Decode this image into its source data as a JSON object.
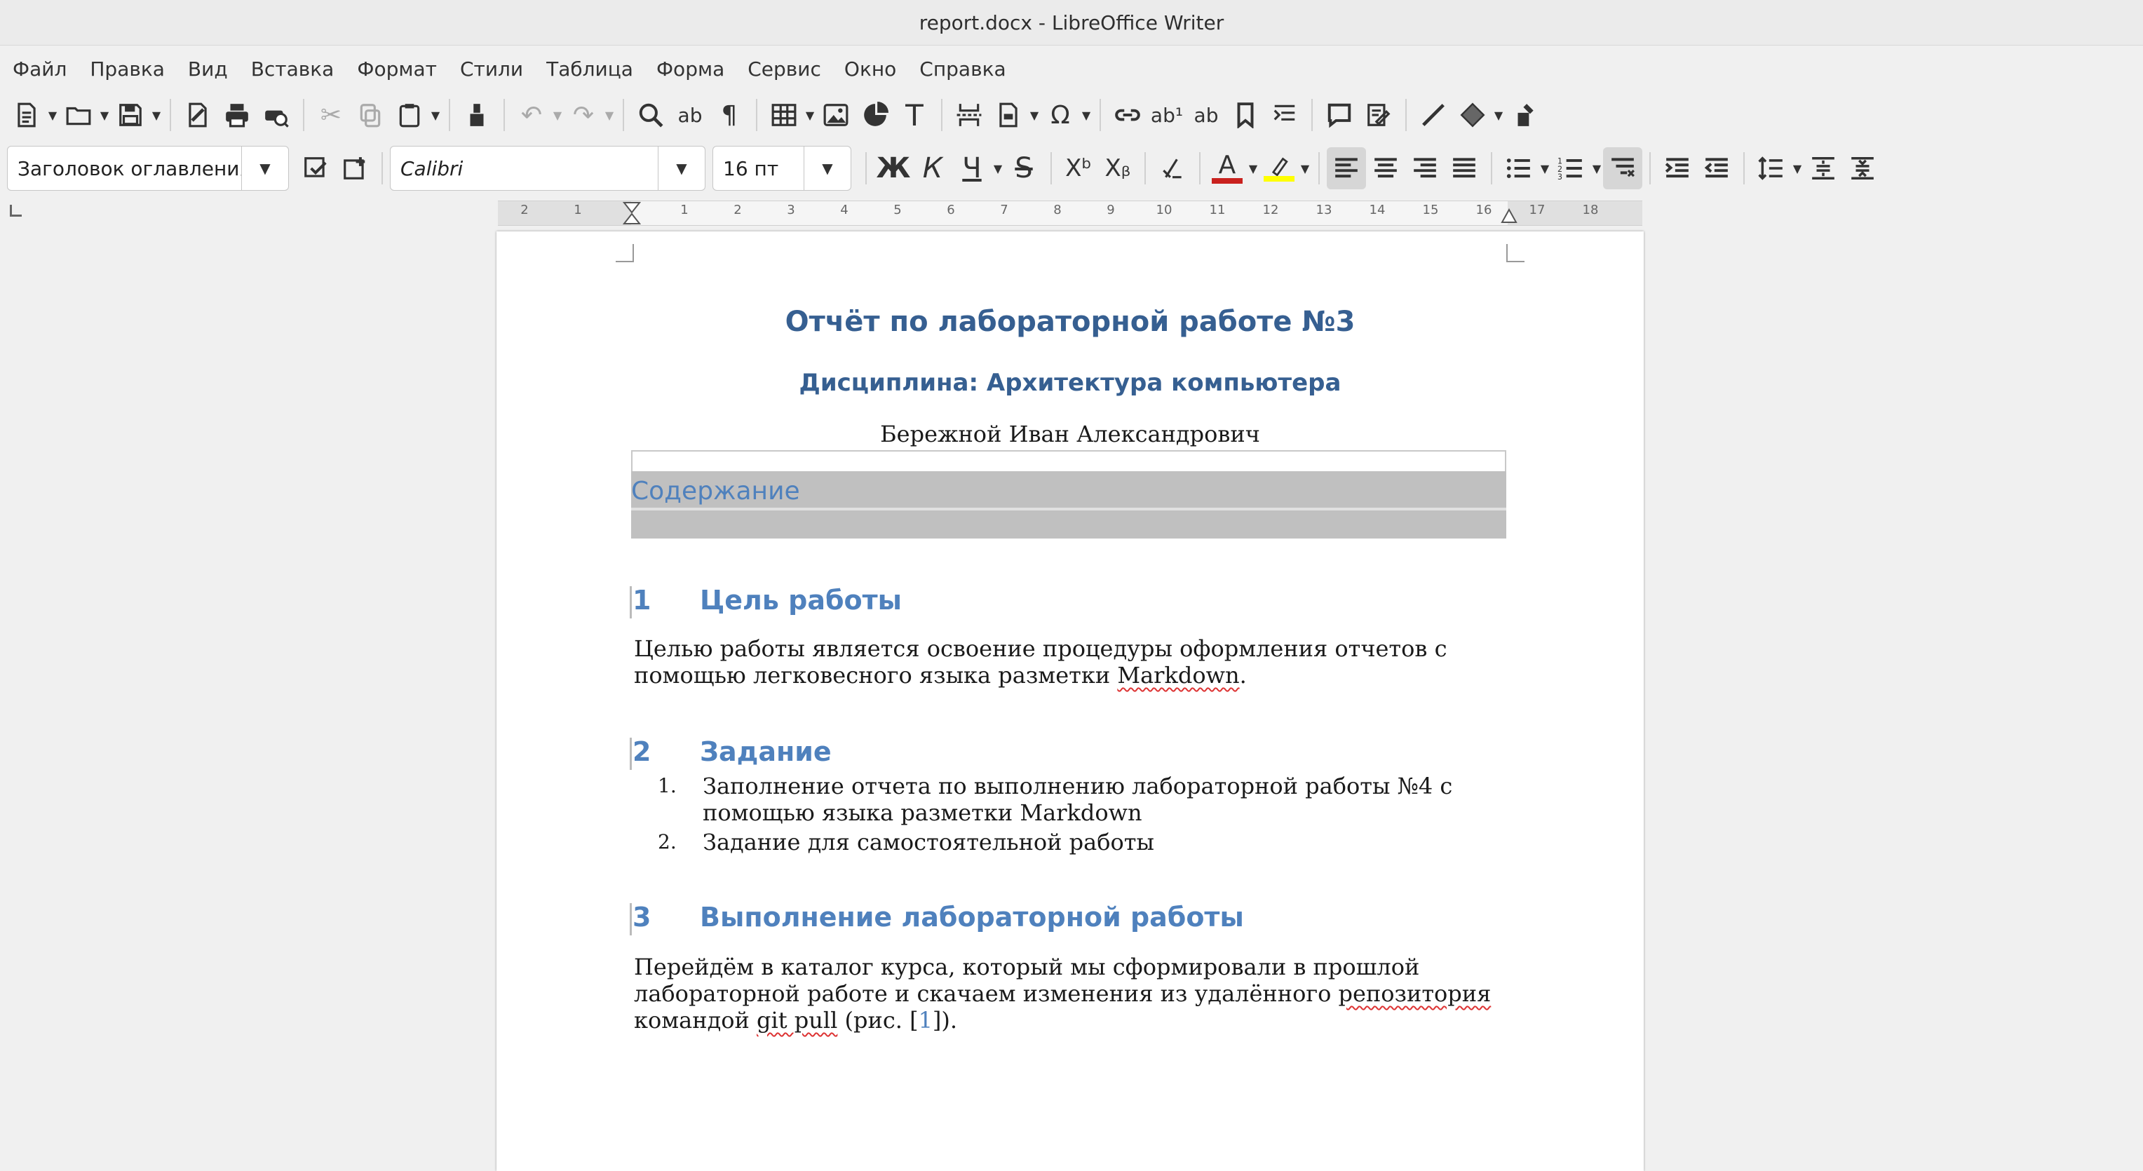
{
  "window": {
    "title": "report.docx - LibreOffice Writer"
  },
  "menu": [
    "Файл",
    "Правка",
    "Вид",
    "Вставка",
    "Формат",
    "Стили",
    "Таблица",
    "Форма",
    "Сервис",
    "Окно",
    "Справка"
  ],
  "formatting": {
    "paragraph_style": "Заголовок оглавления",
    "font_name": "Calibri",
    "font_size": "16 пт"
  },
  "ruler": {
    "labels": [
      "2",
      "1",
      "1",
      "2",
      "3",
      "4",
      "5",
      "6",
      "7",
      "8",
      "9",
      "10",
      "11",
      "12",
      "13",
      "14",
      "15",
      "16",
      "17",
      "18"
    ]
  },
  "document": {
    "title": "Отчёт по лабораторной работе №3",
    "subtitle": "Дисциплина: Архитектура компьютера",
    "author": "Бережной Иван Александрович",
    "toc_heading": "Содержание",
    "sections": [
      {
        "number": "1",
        "heading": "Цель работы",
        "para_line1": "Целью работы является освоение процедуры оформления отчетов с",
        "para_line2_pre": "помощью легковесного языка разметки ",
        "para_line2_word": "Markdown",
        "para_line2_post": "."
      },
      {
        "number": "2",
        "heading": "Задание",
        "items": [
          {
            "n": "1.",
            "line1": "Заполнение отчета по выполнению лабораторной работы №4 с",
            "line2": "помощью языка разметки Markdown"
          },
          {
            "n": "2.",
            "line1": "Задание для самостоятельной работы"
          }
        ]
      },
      {
        "number": "3",
        "heading": "Выполнение лабораторной работы",
        "para_line1": "Перейдём в каталог курса, который мы сформировали в прошлой",
        "para_line2_pre": "лабораторной работе и скачаем изменения из удалённого ",
        "para_line2_word": "репозитория",
        "para_line3_pre": "командой ",
        "para_line3_word": "git pull",
        "para_line3_mid": " (рис. [",
        "para_line3_ref": "1",
        "para_line3_post": "])."
      }
    ]
  },
  "colors": {
    "heading": "#365f91",
    "heading1": "#4f81bd",
    "toc_shade": "#c0c0c0",
    "spell": "#d33333"
  }
}
